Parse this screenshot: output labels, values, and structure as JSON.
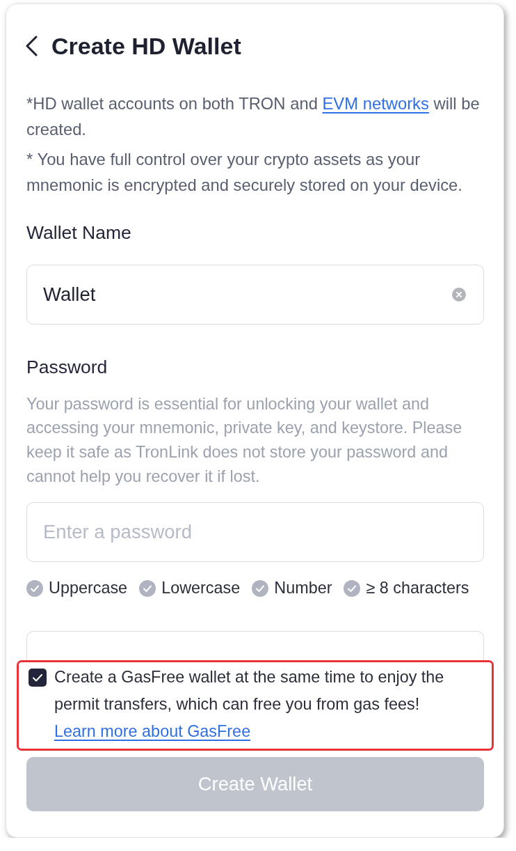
{
  "header": {
    "title": "Create HD Wallet"
  },
  "notes": [
    {
      "parts": [
        {
          "text": "*HD wallet accounts on both TRON and"
        },
        {
          "link": "EVM networks"
        },
        {
          "text": "will be created."
        }
      ]
    },
    {
      "parts": [
        {
          "text": "* You have full control over your crypto assets as your mnemonic is encrypted and securely stored on your device."
        }
      ]
    }
  ],
  "wallet_name": {
    "label": "Wallet Name",
    "value": "Wallet"
  },
  "password": {
    "label": "Password",
    "hint": "Your password is essential for unlocking your wallet and accessing your mnemonic, private key, and keystore. Please keep it safe as TronLink does not store your password and cannot help you recover it if lost.",
    "placeholder": "Enter a password",
    "requirements": [
      {
        "label": "Uppercase",
        "met": false
      },
      {
        "label": "Lowercase",
        "met": false
      },
      {
        "label": "Number",
        "met": false
      },
      {
        "label": "≥ 8 characters",
        "met": false
      }
    ],
    "confirm_field": {
      "cut_off": true
    }
  },
  "gasfree": {
    "checked": true,
    "highlighted": true,
    "text": "Create a GasFree wallet at the same time to enjoy the permit transfers, which can free you from gas fees!",
    "link": "Learn more about GasFree"
  },
  "create_button": {
    "label": "Create Wallet",
    "disabled": true
  }
}
